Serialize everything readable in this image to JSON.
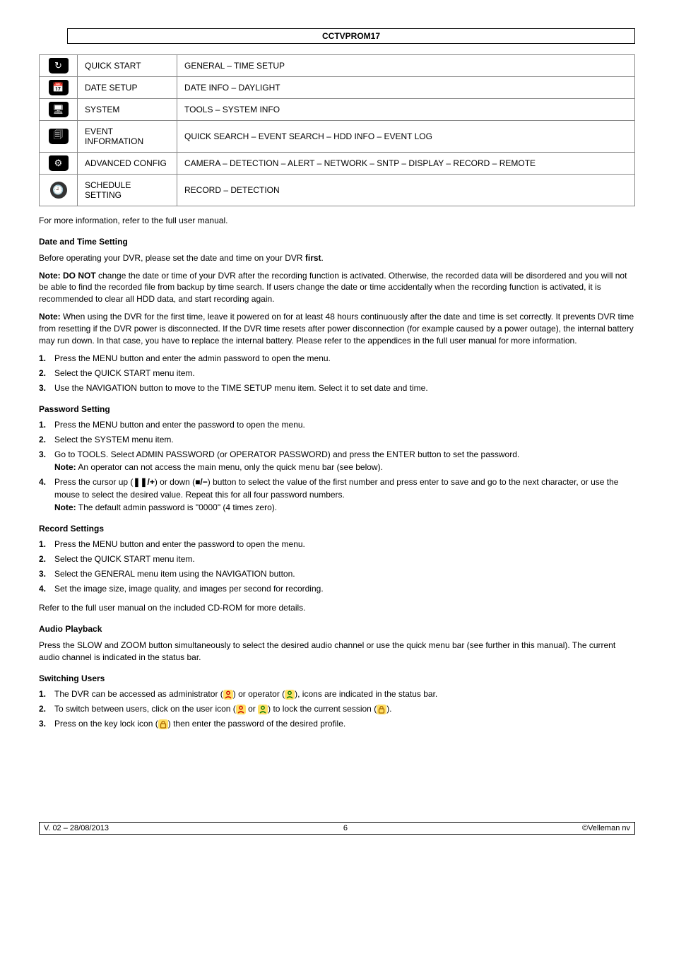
{
  "header": {
    "title": "CCTVPROM17"
  },
  "menu_table": [
    {
      "glyph": "↻",
      "name": "QUICK START",
      "desc": "GENERAL – TIME SETUP"
    },
    {
      "glyph": "📅",
      "name": "DATE SETUP",
      "desc": "DATE INFO – DAYLIGHT"
    },
    {
      "glyph": "🖥",
      "name": "SYSTEM",
      "desc": "TOOLS – SYSTEM INFO"
    },
    {
      "glyph": "🗐",
      "name": "EVENT INFORMATION",
      "desc": "QUICK SEARCH – EVENT SEARCH – HDD INFO – EVENT LOG"
    },
    {
      "glyph": "⚙",
      "name": "ADVANCED CONFIG",
      "desc": "CAMERA – DETECTION – ALERT – NETWORK – SNTP – DISPLAY – RECORD – REMOTE"
    },
    {
      "glyph": "🕘",
      "name": "SCHEDULE SETTING",
      "desc": "RECORD – DETECTION",
      "shape": "round"
    }
  ],
  "note_more": "For more information, refer to the full user manual.",
  "date_time": {
    "title": "Date and Time Setting",
    "intro_pre": "Before operating your DVR, please set the date and time on your DVR ",
    "intro_bold": "first",
    "intro_post": ".",
    "note1_lead": "Note: DO NOT",
    "note1_body": " change the date or time of your DVR after the recording function is activated. Otherwise, the recorded data will be disordered and you will not be able to find the recorded file from backup by time search. If users change the date or time accidentally when the recording function is activated, it is recommended to clear all HDD data, and start recording again.",
    "note2_lead": "Note:",
    "note2_body": " When using the DVR for the first time, leave it powered on for at least 48 hours continuously after the date and time is set correctly. It prevents DVR time from resetting if the DVR power is disconnected. If the DVR time resets after power disconnection (for example caused by a power outage), the internal battery may run down. In that case, you have to replace the internal battery. Please refer to the appendices in the full user manual for more information.",
    "steps": [
      "Press the MENU button and enter the admin password to open the menu.",
      "Select the QUICK START menu item.",
      "Use the NAVIGATION button to move to the TIME SETUP menu item. Select it to set date and time."
    ]
  },
  "password": {
    "title": "Password Setting",
    "steps": {
      "s1": "Press the MENU button and enter the password to open the menu.",
      "s2": "Select the SYSTEM menu item.",
      "s3a": "Go to TOOLS. Select ADMIN PASSWORD (or OPERATOR PASSWORD) and press the ENTER button to set the password.",
      "s3_note_lead": "Note:",
      "s3_note_body": " An operator can not access the main menu, only the quick menu bar (see below).",
      "s4_pre": "Press the cursor up (",
      "s4_sym_up": "❚❚/+",
      "s4_mid": ") or down (",
      "s4_sym_down": "■/−",
      "s4_post": ") button to select the value of the first number and press enter to save and go to the next character, or use the mouse to select the desired value. Repeat this for all four password numbers.",
      "s4_note_lead": "Note:",
      "s4_note_body": " The default admin password is \"0000\" (4 times zero)."
    }
  },
  "record": {
    "title": "Record Settings",
    "steps": [
      "Press the MENU button and enter the password to open the menu.",
      "Select the QUICK START menu item.",
      "Select the GENERAL menu item using the NAVIGATION button.",
      "Set the image size, image quality, and images per second for recording."
    ],
    "tail": "Refer to the full user manual on the included CD-ROM for more details."
  },
  "audio": {
    "title": "Audio Playback",
    "body": "Press the SLOW and ZOOM button simultaneously to select the desired audio channel or use the quick menu bar (see further in this manual). The current audio channel is indicated in the status bar."
  },
  "users": {
    "title": "Switching Users",
    "s1_pre": "The DVR can be accessed as administrator (",
    "s1_mid": ") or operator (",
    "s1_post": "), icons are indicated in the status bar.",
    "s2_pre": "To switch between users, click on the user icon (",
    "s2_or": " or ",
    "s2_mid": ") to lock the current session (",
    "s2_post": ").",
    "s3_pre": "Press on the key lock icon (",
    "s3_post": ") then enter the password of the desired profile."
  },
  "footer": {
    "left": "V. 02 – 28/08/2013",
    "mid": "6",
    "right": "©Velleman nv"
  }
}
